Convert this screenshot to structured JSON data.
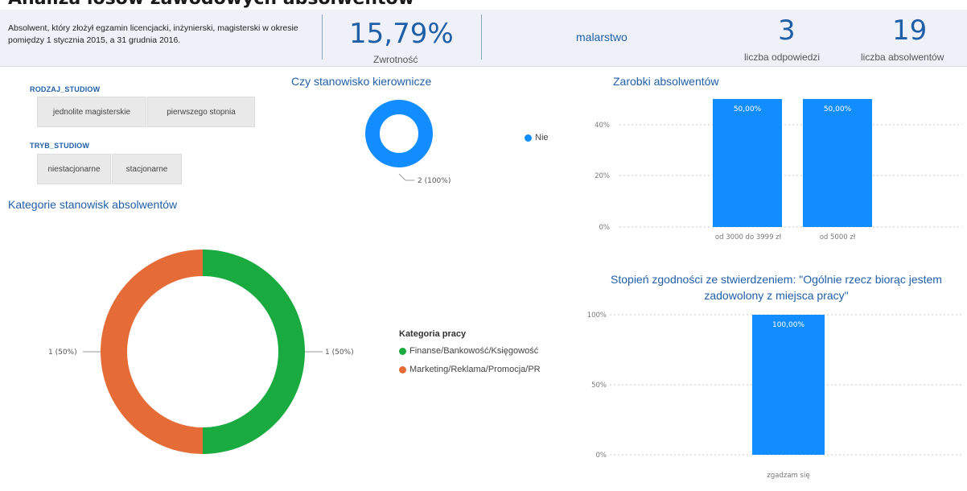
{
  "header": {
    "title": "Analiza losów zawodowych absolwentów"
  },
  "kpi": {
    "description": "Absolwent, który złożył egzamin licencjacki, inżynierski, magisterski w okresie pomiędzy 1  stycznia 2015, a 31 grudnia 2016.",
    "return_rate": "15,79%",
    "return_rate_label": "Zwrotność",
    "field": "malarstwo",
    "responses": "3",
    "responses_label": "liczba odpowiedzi",
    "graduates": "19",
    "graduates_label": "liczba absolwentów"
  },
  "slicers": {
    "rodzaj": {
      "title": "RODZAJ_STUDIOW",
      "options": [
        "jednolite magisterskie",
        "pierwszego stopnia"
      ]
    },
    "tryb": {
      "title": "TRYB_STUDIOW",
      "options": [
        "niestacjonarne",
        "stacjonarne"
      ]
    }
  },
  "colors": {
    "blue": "#118dff",
    "green": "#1aab40",
    "orange": "#e66c37",
    "title_blue": "#1f5fa8"
  },
  "chart_data": [
    {
      "type": "pie",
      "id": "kierownicze",
      "title": "Czy stanowisko kierownicze",
      "categories": [
        "Nie"
      ],
      "values": [
        2
      ],
      "slice_labels": [
        "2 (100%)"
      ],
      "legend": [
        "Nie"
      ],
      "legend_placement": "right"
    },
    {
      "type": "pie",
      "id": "kategorie",
      "title": "Kategorie stanowisk absolwentów",
      "legend_title": "Kategoria pracy",
      "categories": [
        "Finanse/Bankowość/Księgowość",
        "Marketing/Reklama/Promocja/PR"
      ],
      "values": [
        1,
        1
      ],
      "slice_labels": [
        "1 (50%)",
        "1 (50%)"
      ],
      "legend_placement": "right"
    },
    {
      "type": "bar",
      "id": "zarobki",
      "title": "Zarobki absolwentów",
      "categories": [
        "od 3000 do 3999 zł",
        "od 5000 zł"
      ],
      "values": [
        50,
        50
      ],
      "data_labels": [
        "50,00%",
        "50,00%"
      ],
      "y_ticks": [
        "0%",
        "20%",
        "40%"
      ],
      "ylim": [
        0,
        50
      ],
      "grid": true
    },
    {
      "type": "bar",
      "id": "zgodnosc",
      "title": "Stopień zgodności ze stwierdzeniem: \"Ogólnie rzecz biorąc jestem zadowolony z miejsca pracy\"",
      "categories": [
        "zgadzam się"
      ],
      "values": [
        100
      ],
      "data_labels": [
        "100,00%"
      ],
      "y_ticks": [
        "0%",
        "50%",
        "100%"
      ],
      "ylim": [
        0,
        100
      ],
      "grid": true
    }
  ]
}
